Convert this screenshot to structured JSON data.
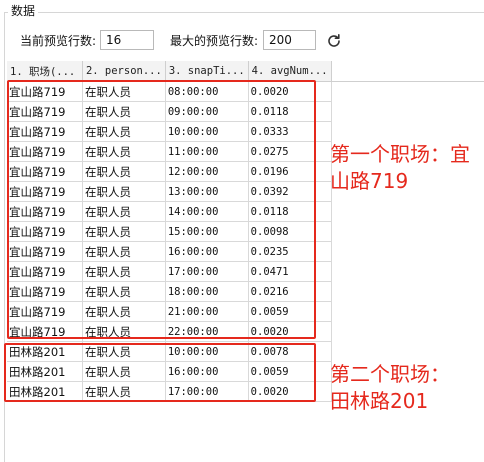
{
  "group_title": "数据",
  "controls": {
    "current_rows_label": "当前预览行数:",
    "current_rows_value": "16",
    "max_rows_label": "最大的预览行数:",
    "max_rows_value": "200",
    "refresh_icon": "refresh-icon"
  },
  "table": {
    "headers": [
      "1. 职场(...",
      "2. person...",
      "3. snapTi...",
      "4. avgNum..."
    ],
    "rows": [
      [
        "宜山路719",
        "在职人员",
        "08:00:00",
        "0.0020"
      ],
      [
        "宜山路719",
        "在职人员",
        "09:00:00",
        "0.0118"
      ],
      [
        "宜山路719",
        "在职人员",
        "10:00:00",
        "0.0333"
      ],
      [
        "宜山路719",
        "在职人员",
        "11:00:00",
        "0.0275"
      ],
      [
        "宜山路719",
        "在职人员",
        "12:00:00",
        "0.0196"
      ],
      [
        "宜山路719",
        "在职人员",
        "13:00:00",
        "0.0392"
      ],
      [
        "宜山路719",
        "在职人员",
        "14:00:00",
        "0.0118"
      ],
      [
        "宜山路719",
        "在职人员",
        "15:00:00",
        "0.0098"
      ],
      [
        "宜山路719",
        "在职人员",
        "16:00:00",
        "0.0235"
      ],
      [
        "宜山路719",
        "在职人员",
        "17:00:00",
        "0.0471"
      ],
      [
        "宜山路719",
        "在职人员",
        "18:00:00",
        "0.0216"
      ],
      [
        "宜山路719",
        "在职人员",
        "21:00:00",
        "0.0059"
      ],
      [
        "宜山路719",
        "在职人员",
        "22:00:00",
        "0.0020"
      ],
      [
        "田林路201",
        "在职人员",
        "10:00:00",
        "0.0078"
      ],
      [
        "田林路201",
        "在职人员",
        "16:00:00",
        "0.0059"
      ],
      [
        "田林路201",
        "在职人员",
        "17:00:00",
        "0.0020"
      ]
    ]
  },
  "annotations": {
    "first_line1": "第一个职场：宜",
    "first_line2": "山路719",
    "second_line1": "第二个职场：",
    "second_line2": "田林路201",
    "color": "#e5291d"
  }
}
